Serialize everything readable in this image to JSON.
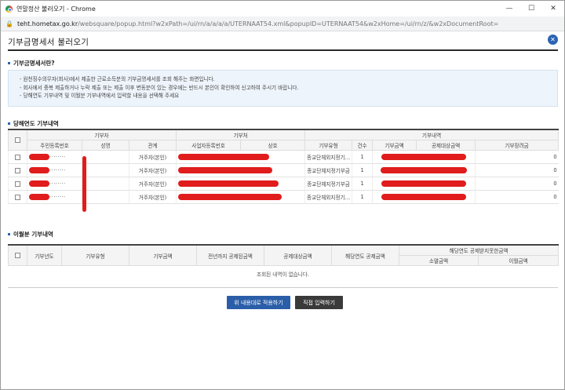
{
  "window": {
    "title": "연말정산 불러오기 - Chrome",
    "url_domain": "teht.hometax.go.kr",
    "url_path": "/websquare/popup.html?w2xPath=/ui/rn/a/a/a/a/UTERNAAT54.xml&popupID=UTERNAAT54&w2xHome=/ui/rn/z/&w2xDocumentRoot="
  },
  "popup": {
    "title": "기부금명세서 불러오기"
  },
  "section1": {
    "title": "기부금명세서란?",
    "lines": [
      "- 원천징수의무자(회사)에서 제출한 근로소득분의 기부금명세서를 조회 해주는 화면입니다.",
      "- 회사에서 중복 제출하거나 누락 제출 또는 제출 이후 변동분이 있는 경우에는 반드시 본인이 확인하여 신고하여 주시기 바랍니다.",
      "- 당해연도 기부내역 및 이월분 기부내역에서 입력할 내용을 선택해 주세요"
    ]
  },
  "section2": {
    "title": "당해연도 기부내역",
    "group_headers": [
      "기부자",
      "기부처",
      "기부내역"
    ],
    "headers": [
      "주민등록번호",
      "성명",
      "관계",
      "사업자등록번호",
      "상호",
      "기부유형",
      "건수",
      "기부금액",
      "공제대상금액",
      "기부장려금"
    ],
    "rows": [
      {
        "rrn_mask": "········",
        "relation": "거주자(본인)",
        "type": "종교단체외지정기…",
        "count": "1",
        "incentive": "0"
      },
      {
        "rrn_mask": "········",
        "relation": "거주자(본인)",
        "type": "종교단체지정기부금",
        "count": "1",
        "incentive": "0"
      },
      {
        "rrn_mask": "········",
        "relation": "거주자(본인)",
        "type": "종교단체지정기부금",
        "count": "1",
        "incentive": "0"
      },
      {
        "rrn_mask": "········",
        "relation": "거주자(본인)",
        "type": "종교단체외지정기…",
        "count": "1",
        "incentive": "0"
      }
    ]
  },
  "section3": {
    "title": "이월분 기부내역",
    "headers": [
      "기부년도",
      "기부유형",
      "기부금액",
      "전년까지 공제된금액",
      "공제대상금액",
      "해당연도 공제금액"
    ],
    "group_header": "해당연도 공제받지못한금액",
    "sub_headers": [
      "소멸금액",
      "이월금액"
    ],
    "empty_message": "조회된 내역이 없습니다."
  },
  "buttons": {
    "apply": "위 내용대로 적용하기",
    "manual": "직접 입력하기"
  },
  "colors": {
    "accent": "#2b5ea8",
    "redaction": "#e01c1c"
  }
}
